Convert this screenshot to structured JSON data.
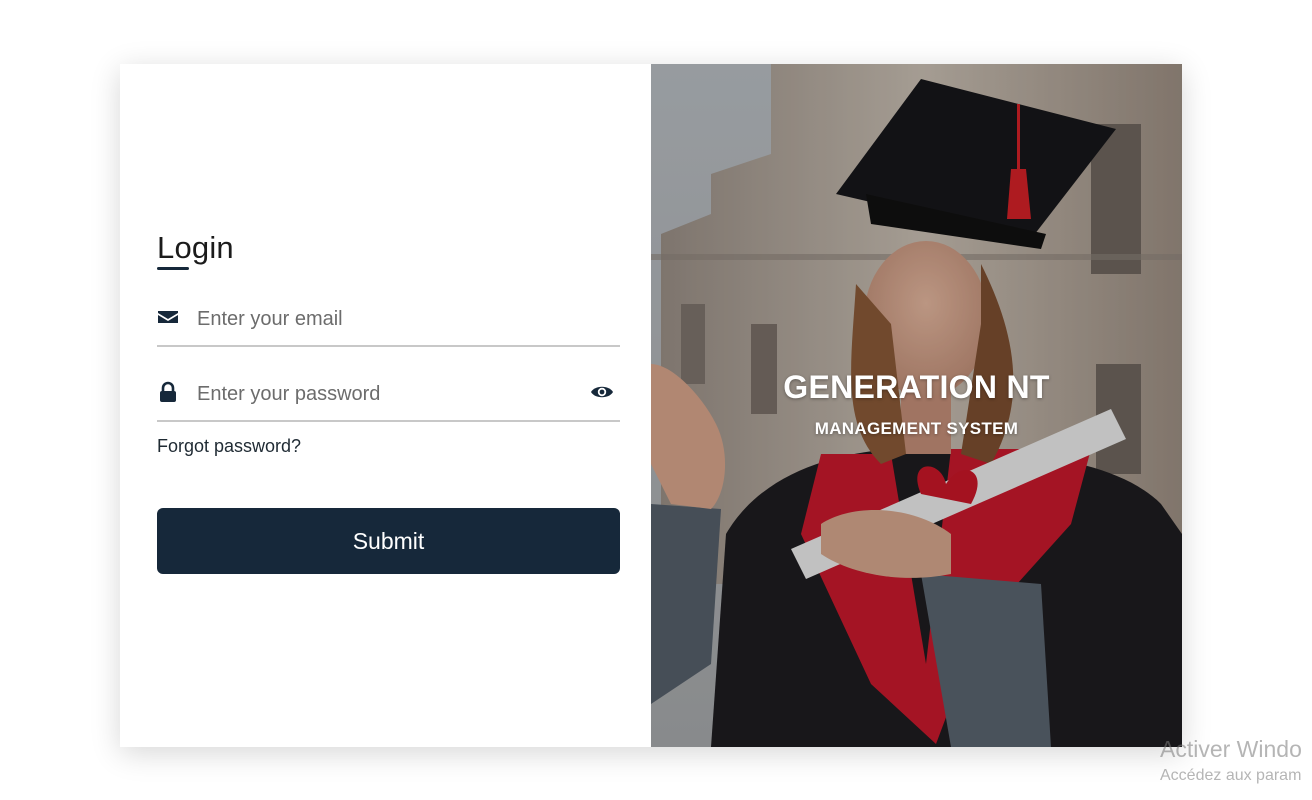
{
  "login": {
    "title": "Login",
    "email_placeholder": "Enter your email",
    "password_placeholder": "Enter your password",
    "forgot_link": "Forgot password?",
    "submit_label": "Submit",
    "icons": {
      "email": "envelope-icon",
      "password": "lock-icon",
      "toggle": "eye-icon"
    }
  },
  "hero": {
    "title": "GENERATION NT",
    "subtitle": "MANAGEMENT SYSTEM"
  },
  "watermark": {
    "line1": "Activer Windo",
    "line2": "Accédez aux param"
  },
  "colors": {
    "primary": "#16283a",
    "underline": "#c8c8c8"
  }
}
